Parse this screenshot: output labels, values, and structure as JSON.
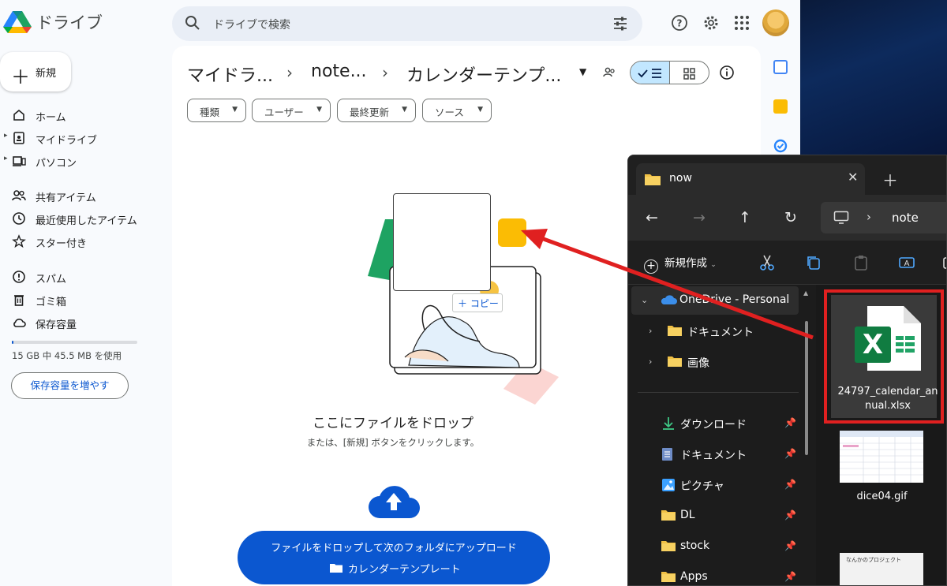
{
  "drive": {
    "product_name": "ドライブ",
    "search_placeholder": "ドライブで検索",
    "new_label": "新規",
    "nav": [
      {
        "label": "ホーム"
      },
      {
        "label": "マイドライブ"
      },
      {
        "label": "パソコン"
      },
      {
        "label": "共有アイテム"
      },
      {
        "label": "最近使用したアイテム"
      },
      {
        "label": "スター付き"
      },
      {
        "label": "スパム"
      },
      {
        "label": "ゴミ箱"
      },
      {
        "label": "保存容量"
      }
    ],
    "storage": {
      "text": "15 GB 中 45.5 MB を使用",
      "used_fraction": 0.01,
      "button": "保存容量を増やす"
    },
    "breadcrumb": [
      "マイドラ...",
      "note...",
      "カレンダーテンプ..."
    ],
    "filters": [
      "種類",
      "ユーザー",
      "最終更新",
      "ソース"
    ],
    "drop": {
      "copy_badge": "コピー",
      "title": "ここにファイルをドロップ",
      "subtitle": "または、[新規] ボタンをクリックします。",
      "upload_line1": "ファイルをドロップして次のフォルダにアップロード",
      "upload_folder": "カレンダーテンプレート"
    }
  },
  "explorer": {
    "tab_title": "now",
    "address": "note",
    "new_label": "新規作成",
    "tree": [
      {
        "label": "OneDrive - Personal",
        "icon": "cloud-icon"
      },
      {
        "label": "ドキュメント",
        "icon": "folder-icon"
      },
      {
        "label": "画像",
        "icon": "folder-icon"
      },
      {
        "label": "ダウンロード",
        "icon": "download-icon"
      },
      {
        "label": "ドキュメント",
        "icon": "document-icon"
      },
      {
        "label": "ピクチャ",
        "icon": "picture-icon"
      },
      {
        "label": "DL",
        "icon": "folder-icon"
      },
      {
        "label": "stock",
        "icon": "folder-icon"
      },
      {
        "label": "Apps",
        "icon": "folder-icon"
      }
    ],
    "files": [
      {
        "name": "24797_calendar_annual.xlsx"
      },
      {
        "name": "dice04.gif"
      }
    ],
    "thumb3_text": "なんかのプロジェクト"
  },
  "colors": {
    "accent": "#0b57d0",
    "highlight": "#e02020",
    "excel": "#107c41"
  }
}
